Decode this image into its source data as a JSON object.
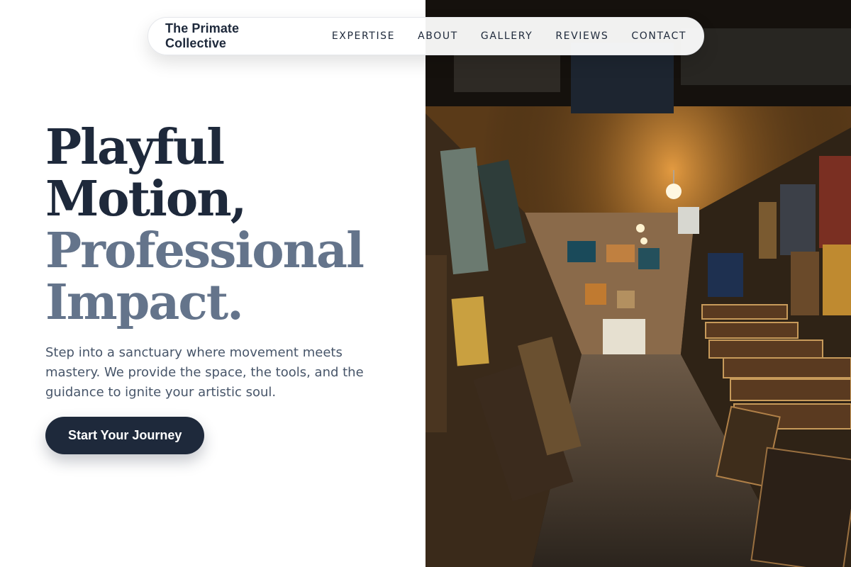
{
  "nav": {
    "brand": "The Primate Collective",
    "links": [
      "EXPERTISE",
      "ABOUT",
      "GALLERY",
      "REVIEWS",
      "CONTACT"
    ]
  },
  "hero": {
    "headline_line1": "Playful",
    "headline_line2": "Motion,",
    "headline_line3": "Professional",
    "headline_line4": "Impact.",
    "lede": "Step into a sanctuary where movement meets mastery. We provide the space, the tools, and the guidance to ignite your artistic soul.",
    "cta_label": "Start Your Journey"
  },
  "photo": {
    "subject": "art-gallery-corridor-photo"
  },
  "colors": {
    "primary_dark": "#1e293b",
    "muted_heading": "#64748b",
    "body_text": "#475569",
    "background": "#ffffff"
  }
}
